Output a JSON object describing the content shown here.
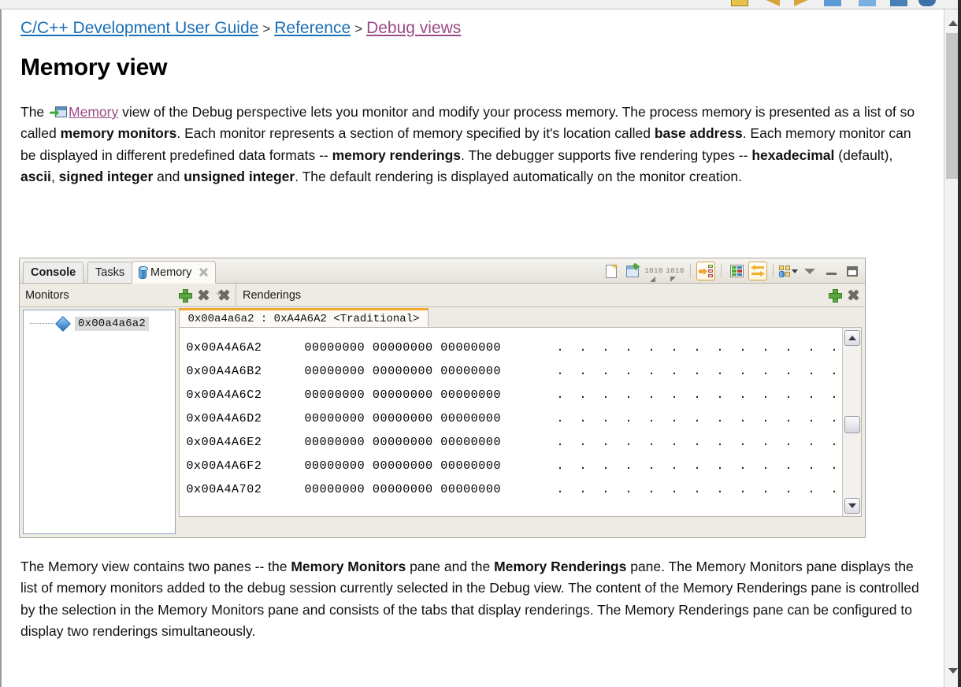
{
  "breadcrumb": {
    "items": [
      {
        "label": "C/C++ Development User Guide",
        "state": "link"
      },
      {
        "label": "Reference",
        "state": "link"
      },
      {
        "label": "Debug views",
        "state": "visited"
      }
    ],
    "separator": ">"
  },
  "page": {
    "title": "Memory view",
    "intro_1": "The ",
    "intro_link": "Memory",
    "intro_2": " view of the Debug perspective lets you monitor and modify your process memory. The process memory is presented as a list of so called ",
    "b_memory_monitors": "memory monitors",
    "intro_3": ". Each monitor represents a section of memory specified by it's location called ",
    "b_base_address": "base address",
    "intro_4": ". Each memory monitor can be displayed in different predefined data formats -- ",
    "b_memory_renderings": "memory renderings",
    "intro_5": ". The debugger supports five rendering types -- ",
    "b_hexadecimal": "hexadecimal",
    "intro_6": " (default), ",
    "b_ascii": "ascii",
    "intro_7": ", ",
    "b_signed_integer": "signed integer",
    "intro_8": " and ",
    "b_unsigned_integer": "unsigned integer",
    "intro_9": ". The default rendering is displayed automatically on the monitor creation.",
    "outro_1": "The Memory view contains two panes -- the ",
    "b_memory_monitors_pane": "Memory Monitors",
    "outro_2": " pane and the ",
    "b_memory_renderings_pane": "Memory Renderings",
    "outro_3": " pane. The Memory Monitors pane displays the list of memory monitors added to the debug session currently selected in the Debug view. The content of the Memory Renderings pane is controlled by the selection in the Memory Monitors pane and consists of the tabs that display renderings. The Memory Renderings pane can be configured to display two renderings simultaneously."
  },
  "eclipse": {
    "view_tabs": [
      {
        "label": "Console",
        "active": false,
        "bold": true
      },
      {
        "label": "Tasks",
        "active": false,
        "bold": false
      },
      {
        "label": "Memory",
        "active": true,
        "bold": false
      }
    ],
    "toolbar": [
      {
        "name": "new-memory-monitor-icon",
        "title": ""
      },
      {
        "name": "add-rendering-icon",
        "title": ""
      },
      {
        "name": "next-page-icon",
        "title": ""
      },
      {
        "name": "previous-page-icon",
        "title": ""
      },
      {
        "name": "go-to-address-icon",
        "title": ""
      },
      {
        "name": "toggle-split-pane-icon",
        "title": ""
      },
      {
        "name": "link-memory-rendering-icon",
        "title": ""
      },
      {
        "name": "view-layout-menu-icon",
        "title": ""
      },
      {
        "name": "view-menu-icon",
        "title": ""
      },
      {
        "name": "minimize-icon",
        "title": ""
      },
      {
        "name": "maximize-icon",
        "title": ""
      }
    ],
    "monitors_pane": {
      "title": "Monitors",
      "actions": [
        "add-monitor-icon",
        "remove-monitor-icon",
        "remove-all-monitors-icon"
      ],
      "items": [
        {
          "label": "0x00a4a6a2",
          "selected": true
        }
      ]
    },
    "renderings_pane": {
      "title": "Renderings",
      "actions": [
        "add-rendering-icon",
        "remove-rendering-icon"
      ],
      "tab_label": "0x00a4a6a2 : 0xA4A6A2 <Traditional>",
      "columns": [
        "address",
        "hex",
        "ascii"
      ],
      "rows": [
        {
          "address": "0x00A4A6A2",
          "hex": "00000000 00000000 00000000",
          "ascii": ". . . . . . . . . . . . ."
        },
        {
          "address": "0x00A4A6B2",
          "hex": "00000000 00000000 00000000",
          "ascii": ". . . . . . . . . . . . ."
        },
        {
          "address": "0x00A4A6C2",
          "hex": "00000000 00000000 00000000",
          "ascii": ". . . . . . . . . . . . ."
        },
        {
          "address": "0x00A4A6D2",
          "hex": "00000000 00000000 00000000",
          "ascii": ". . . . . . . . . . . . ."
        },
        {
          "address": "0x00A4A6E2",
          "hex": "00000000 00000000 00000000",
          "ascii": ". . . . . . . . . . . . ."
        },
        {
          "address": "0x00A4A6F2",
          "hex": "00000000 00000000 00000000",
          "ascii": ". . . . . . . . . . . . ."
        },
        {
          "address": "0x00A4A702",
          "hex": "00000000 00000000 00000000",
          "ascii": ". . . . . . . . . . . . ."
        }
      ]
    }
  },
  "colors": {
    "link": "#1b6fb5",
    "visited_link": "#9a4a86",
    "accent_orange": "#f0a830",
    "panel_bg": "#edebe4",
    "selection": "#dcdcdc"
  }
}
